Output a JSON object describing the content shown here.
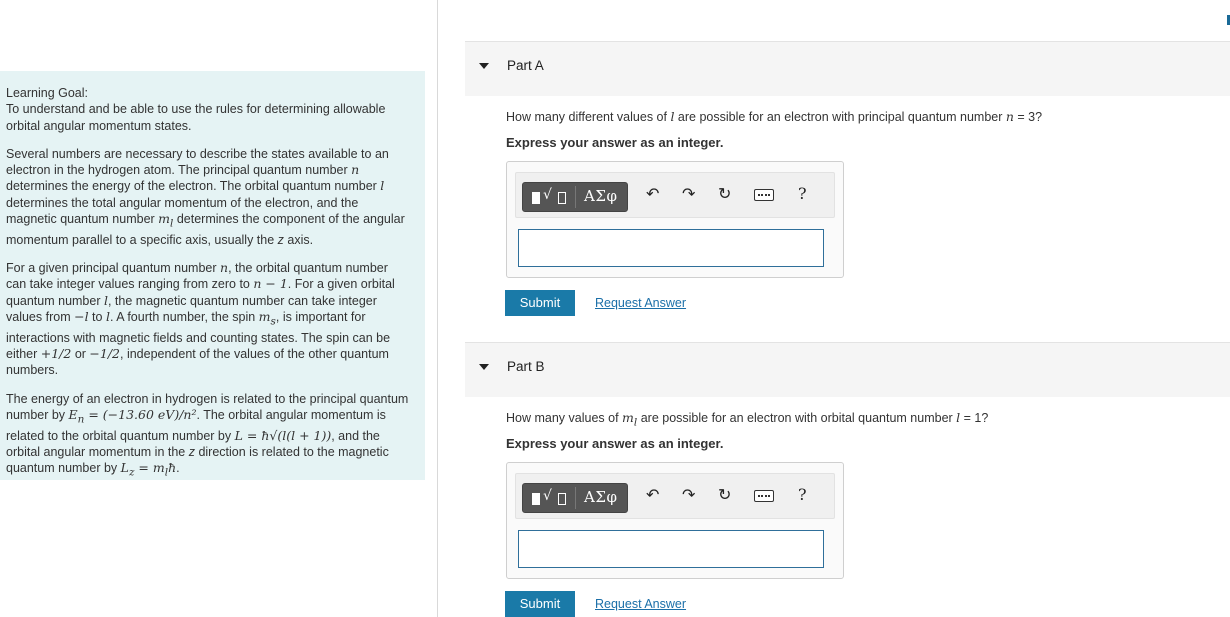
{
  "learning_goal": {
    "header": "Learning Goal:",
    "goal_text": "To understand and be able to use the rules for determining allowable orbital angular momentum states.",
    "para1": {
      "t1": "Several numbers are necessary to describe the states available to an electron in the hydrogen atom. The principal quantum number ",
      "m1": "n",
      "t2": " determines the energy of the electron. The orbital quantum number ",
      "m2": "l",
      "t3": " determines the total angular momentum of the electron, and the magnetic quantum number ",
      "m3": "m",
      "m3sub": "l",
      "t4": " determines the component of the angular momentum parallel to a specific axis, usually the ",
      "t5": "z",
      "t6": " axis."
    },
    "para2": {
      "t1": "For a given principal quantum number ",
      "m1": "n",
      "t2": ", the orbital quantum number can take integer values ranging from zero to ",
      "m2": "n − 1",
      "t3": ". For a given orbital quantum number ",
      "m3": "l",
      "t4": ", the magnetic quantum number can take integer values from ",
      "m4": "−l",
      "t5": " to ",
      "m5": "l",
      "t6": ". A fourth number, the spin ",
      "m6": "m",
      "m6sub": "s",
      "t7": ", is important for interactions with magnetic fields and counting states. The spin can be either ",
      "m7": "+1/2",
      "t8": " or ",
      "m8": "−1/2",
      "t9": ", independent of the values of the other quantum numbers."
    },
    "para3": {
      "t1": "The energy of an electron in hydrogen is related to the principal quantum number by ",
      "m1": "E",
      "m1sub": "n",
      "m1rest": " = (−13.60 eV)/n²",
      "t2": ". The orbital angular momentum is related to the orbital quantum number by ",
      "m2": "L = ħ√(l(l + 1))",
      "t3": ", and the orbital angular momentum in the ",
      "t4": "z",
      "t5": " direction is related to the magnetic quantum number by ",
      "m3": "L",
      "m3sub": "z",
      "m3rest": " = m",
      "m3sub2": "l",
      "m3end": "ħ",
      "t6": "."
    }
  },
  "parts": [
    {
      "title": "Part A",
      "q1": "How many different values of ",
      "qm": "l",
      "q2": " are possible for an electron with principal quantum number ",
      "qm2": "n",
      "q3": " = 3?",
      "instruction": "Express your answer as an integer.",
      "input_value": "",
      "submit": "Submit",
      "request": "Request Answer"
    },
    {
      "title": "Part B",
      "q1": "How many values of ",
      "qm": "m",
      "qmsub": "l",
      "q2": " are possible for an electron with orbital quantum number ",
      "qm2": "l",
      "q3": " = 1?",
      "instruction": "Express your answer as an integer.",
      "input_value": "",
      "submit": "Submit",
      "request": "Request Answer"
    }
  ],
  "toolbar": {
    "template_radical": "√",
    "symbols_label": "ΑΣφ",
    "undo_glyph": "↶",
    "redo_glyph": "↷",
    "reset_glyph": "↻",
    "help_glyph": "?",
    "icons": [
      "templates-icon",
      "symbols-icon",
      "undo-icon",
      "redo-icon",
      "reset-icon",
      "keyboard-icon",
      "help-icon"
    ]
  },
  "colors": {
    "goal_bg": "#e5f3f4",
    "submit_bg": "#1a7aa8",
    "link": "#1b6fa8"
  }
}
